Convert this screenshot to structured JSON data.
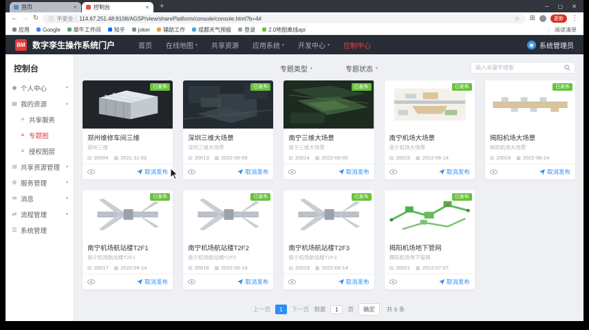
{
  "colors": {
    "accent_blue": "#2a8ff7",
    "brand_red": "#e23c3c",
    "badge_green": "#67c23a",
    "nav_dark": "#272c35"
  },
  "browser": {
    "tabs": [
      {
        "title": "首页",
        "favicon_color": "#4a8cd2"
      },
      {
        "title": "控制台",
        "favicon_color": "#d9534f",
        "active": true
      }
    ],
    "security_label": "不安全",
    "url": "114.67.251.48:9108/AGSP/view/sharePlatform/console/console.html?b=4#",
    "update_badge": "更新",
    "reading_list": "阅读清单",
    "bookmarks": [
      {
        "label": "应用",
        "color": "#7f868d"
      },
      {
        "label": "Google",
        "color": "#4285f4"
      },
      {
        "label": "犀牛工作间",
        "color": "#5aa374"
      },
      {
        "label": "知乎",
        "color": "#0a6cff"
      },
      {
        "label": "joker",
        "color": "#8a8f94"
      },
      {
        "label": "辅助工作",
        "color": "#e6a23c"
      },
      {
        "label": "成都天气预报",
        "color": "#49a8d8"
      },
      {
        "label": "登录",
        "color": "#9aa0a6"
      },
      {
        "label": "2.0地图离线api",
        "color": "#67c23a"
      }
    ]
  },
  "appnav": {
    "logo_text": "BM",
    "title": "数字孪生操作系统门户",
    "items": [
      {
        "label": "首页"
      },
      {
        "label": "在线地图",
        "caret": true
      },
      {
        "label": "共享资源"
      },
      {
        "label": "应用系统",
        "caret": true
      },
      {
        "label": "开发中心",
        "caret": true
      },
      {
        "label": "控制中心",
        "active": true
      }
    ],
    "user": "系统管理员"
  },
  "sidebar": {
    "title": "控制台",
    "items": [
      {
        "label": "个人中心",
        "icon": "user-icon",
        "caret": "down"
      },
      {
        "label": "我的资源",
        "icon": "folder-icon",
        "caret": "up"
      },
      {
        "label": "共享服务",
        "icon": "list-icon",
        "level": 1
      },
      {
        "label": "专题图",
        "icon": "list-icon",
        "level": 1,
        "active": true
      },
      {
        "label": "授权图层",
        "icon": "list-icon",
        "level": 1
      },
      {
        "label": "共享资源管理",
        "icon": "share-icon",
        "caret": "down"
      },
      {
        "label": "服务管理",
        "icon": "service-icon",
        "caret": "down"
      },
      {
        "label": "消息",
        "icon": "message-icon",
        "caret": "down"
      },
      {
        "label": "流程管理",
        "icon": "flow-icon",
        "caret": "down"
      },
      {
        "label": "系统管理",
        "icon": "system-icon"
      }
    ]
  },
  "main": {
    "filters": [
      {
        "label": "专题类型"
      },
      {
        "label": "专题状态"
      }
    ],
    "search_placeholder": "输入关键字搜索",
    "cards": [
      {
        "title": "郑州维修车间三维",
        "subtitle": "郑州三维",
        "id": "20004",
        "date": "2021-11-03",
        "status": "已发布",
        "action": "取消发布",
        "thumb": "warehouse"
      },
      {
        "title": "深圳三维大场景",
        "subtitle": "深圳三维大场景",
        "id": "20013",
        "date": "2022-05-05",
        "status": "已发布",
        "action": "取消发布",
        "thumb": "satellite-dark"
      },
      {
        "title": "南宁三维大场景",
        "subtitle": "南宁三维大场景",
        "id": "20014",
        "date": "2022-05-05",
        "status": "已发布",
        "action": "取消发布",
        "thumb": "satellite-green"
      },
      {
        "title": "南宁机场大场景",
        "subtitle": "南宁机场大场景",
        "id": "20015",
        "date": "2022-06-14",
        "status": "已发布",
        "action": "取消发布",
        "thumb": "airport-map"
      },
      {
        "title": "揭阳机场大场景",
        "subtitle": "揭阳机场大场景",
        "id": "20016",
        "date": "2022-06-14",
        "status": "已发布",
        "action": "取消发布",
        "thumb": "terminal-strip"
      },
      {
        "title": "南宁机场航站楼T2F1",
        "subtitle": "南宁机场航站楼T2F1",
        "id": "20017",
        "date": "2022-06-14",
        "status": "已发布",
        "action": "取消发布",
        "thumb": "terminal-plan"
      },
      {
        "title": "南宁机场航站楼T2F2",
        "subtitle": "南宁机场航站楼T2F2",
        "id": "20018",
        "date": "2022-05-14",
        "status": "已发布",
        "action": "取消发布",
        "thumb": "terminal-plan"
      },
      {
        "title": "南宁机场航站楼T2F3",
        "subtitle": "南宁机场航站楼T2F3",
        "id": "20019",
        "date": "2022-06-14",
        "status": "已发布",
        "action": "取消发布",
        "thumb": "terminal-plan"
      },
      {
        "title": "揭阳机场地下管网",
        "subtitle": "揭阳机场地下管网",
        "id": "20021",
        "date": "2022-07-07",
        "status": "已发布",
        "action": "取消发布",
        "thumb": "pipes"
      }
    ],
    "pagination": {
      "prev": "上一页",
      "current": "1",
      "next": "下一页",
      "jump_prefix": "到第",
      "jump_value": "1",
      "jump_suffix": "页",
      "confirm": "确定",
      "total": "共 9 条"
    }
  }
}
